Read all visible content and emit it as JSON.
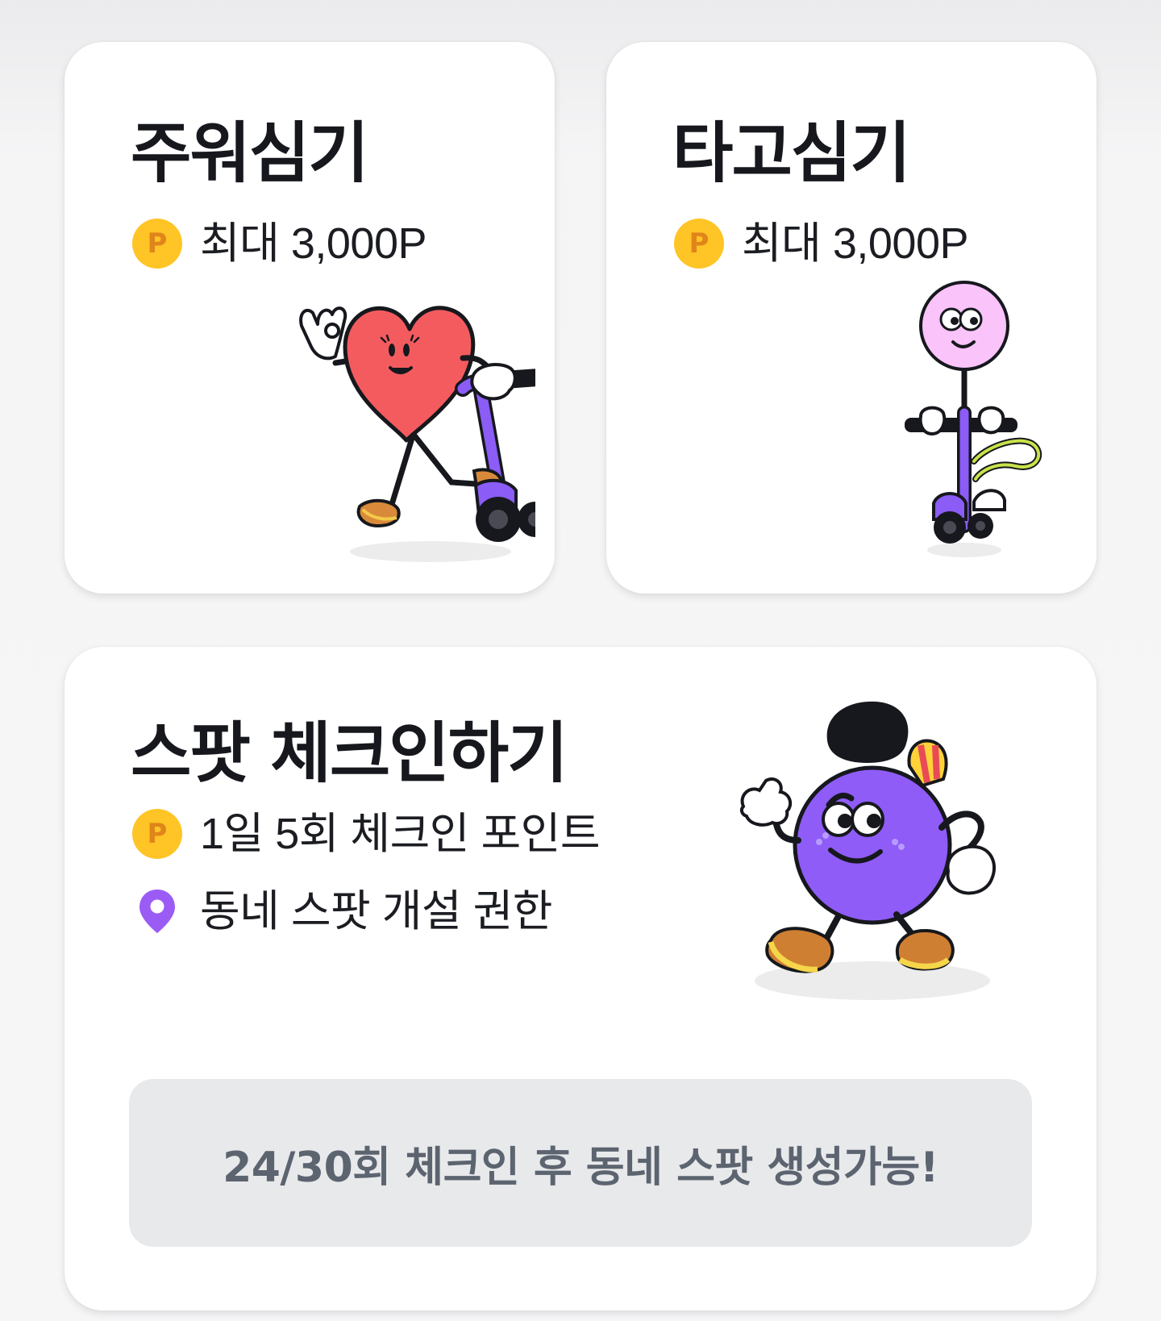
{
  "cards": [
    {
      "title": "주워심기",
      "perk_icon": "point-coin-icon",
      "perk_icon_glyph": "P",
      "perk_text": "최대 3,000P",
      "character": "heart-character-scooter"
    },
    {
      "title": "타고심기",
      "perk_icon": "point-coin-icon",
      "perk_icon_glyph": "P",
      "perk_text": "최대 3,000P",
      "character": "pink-ball-character-scooter"
    }
  ],
  "spot_card": {
    "title": "스팟 체크인하기",
    "perks": [
      {
        "icon": "point-coin-icon",
        "icon_glyph": "P",
        "text": "1일 5회 체크인 포인트"
      },
      {
        "icon": "location-pin-icon",
        "text": "동네 스팟 개설 권한"
      }
    ],
    "character": "purple-ball-character-walking",
    "status": "24/30회 체크인 후 동네 스팟 생성가능!"
  },
  "colors": {
    "coin": "#ffc425",
    "coin_text": "#e0851a",
    "pin": "#9b5cf5",
    "status_bg": "#e8e9eb",
    "status_text": "#5c6470",
    "heart": "#f45b5f",
    "scooter": "#8b5cf6",
    "purple_character": "#8f5cf7",
    "pink_character": "#fac3fa"
  }
}
